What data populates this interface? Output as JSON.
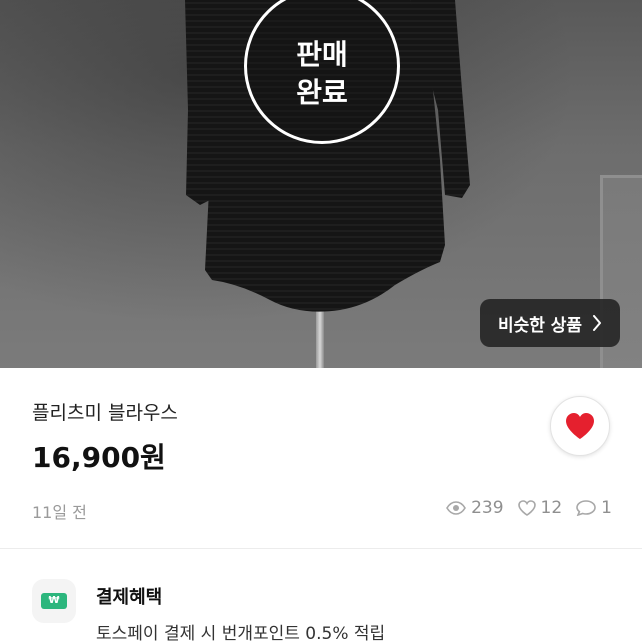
{
  "photo": {
    "sold_badge": {
      "line1": "판매",
      "line2": "완료"
    },
    "similar_button": {
      "label": "비슷한 상품"
    }
  },
  "product": {
    "title": "플리츠미 블라우스",
    "price": "16,900원",
    "posted": "11일 전",
    "stats": {
      "views": "239",
      "likes": "12",
      "chats": "1"
    }
  },
  "benefit": {
    "icon_text": "₩",
    "title": "결제혜택",
    "description": "토스페이 결제 시 번개포인트 0.5% 적립"
  },
  "colors": {
    "like_heart": "#e5202e",
    "benefit_card": "#2cb67d",
    "similar_button_bg": "#222222"
  },
  "icons": {
    "like": "heart-icon",
    "views": "eye-icon",
    "likes": "heart-outline-icon",
    "chats": "chat-bubble-icon",
    "similar": "chevron-right-icon",
    "benefit": "payment-card-icon"
  }
}
